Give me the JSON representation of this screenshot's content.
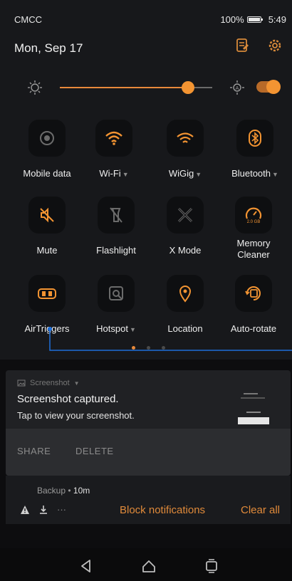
{
  "status": {
    "carrier": "CMCC",
    "battery": "100%",
    "time": "5:49"
  },
  "header": {
    "date": "Mon, Sep 17"
  },
  "brightness": {
    "level": 0.84,
    "auto": true
  },
  "tiles": [
    {
      "label": "Mobile data",
      "caret": "",
      "active": false
    },
    {
      "label": "Wi-Fi",
      "caret": "▼",
      "active": true
    },
    {
      "label": "WiGig",
      "caret": "▼",
      "active": true
    },
    {
      "label": "Bluetooth",
      "caret": "▼",
      "active": true
    },
    {
      "label": "Mute",
      "caret": "",
      "active": true
    },
    {
      "label": "Flashlight",
      "caret": "",
      "active": false
    },
    {
      "label": "X Mode",
      "caret": "",
      "active": false
    },
    {
      "label": "Memory Cleaner",
      "caret": "",
      "active": true
    },
    {
      "label": "AirTriggers",
      "caret": "",
      "active": true
    },
    {
      "label": "Hotspot",
      "caret": "▼",
      "active": false
    },
    {
      "label": "Location",
      "caret": "",
      "active": true
    },
    {
      "label": "Auto-rotate",
      "caret": "",
      "active": true
    }
  ],
  "memory_badge": "2.0 GB",
  "notification": {
    "app": "Screenshot",
    "title": "Screenshot captured.",
    "text": "Tap to view your screenshot.",
    "actions": {
      "share": "SHARE",
      "delete": "DELETE"
    }
  },
  "summary": {
    "app": "Backup",
    "age": "10m",
    "more": "···",
    "block": "Block notifications",
    "clear": "Clear all"
  },
  "colors": {
    "accent": "#f39432",
    "shade_bg": "#17181b",
    "inactive_icon": "#6b6b6b"
  }
}
